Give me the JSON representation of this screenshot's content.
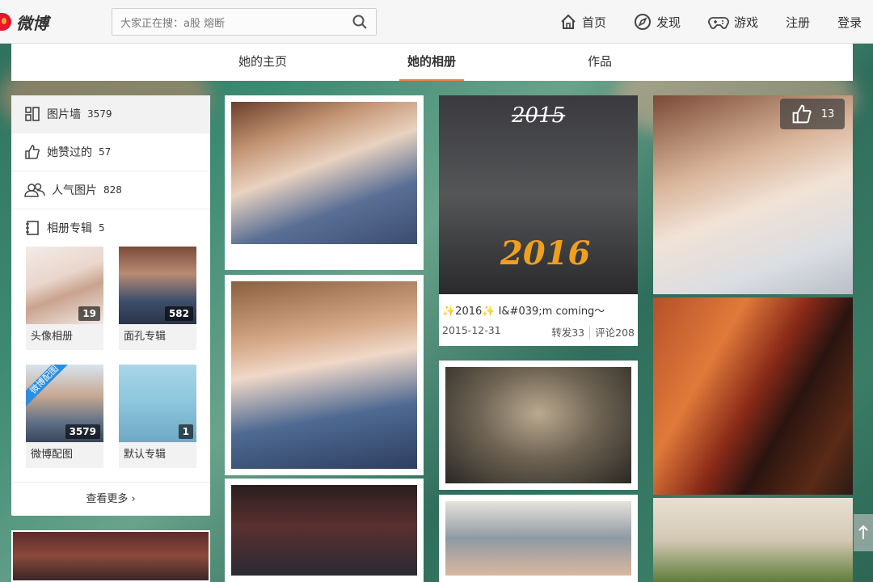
{
  "header": {
    "logo_text": "微博",
    "search_placeholder": "大家正在搜：a股 熔断",
    "nav": [
      {
        "label": "首页",
        "icon": "home-icon"
      },
      {
        "label": "发现",
        "icon": "compass-icon"
      },
      {
        "label": "游戏",
        "icon": "gamepad-icon"
      },
      {
        "label": "注册"
      },
      {
        "label": "登录"
      }
    ]
  },
  "tabs": [
    {
      "label": "她的主页",
      "active": false
    },
    {
      "label": "她的相册",
      "active": true
    },
    {
      "label": "作品",
      "active": false
    }
  ],
  "sidebar": {
    "items": [
      {
        "label": "图片墙",
        "count": "3579",
        "icon": "grid-icon",
        "active": true
      },
      {
        "label": "她赞过的",
        "count": "57",
        "icon": "thumbs-up-icon",
        "active": false
      },
      {
        "label": "人气图片",
        "count": "828",
        "icon": "people-icon",
        "active": false
      }
    ],
    "albums_title": "相册专辑",
    "albums_count": "5",
    "albums": [
      {
        "label": "头像相册",
        "count": "19"
      },
      {
        "label": "面孔专辑",
        "count": "582"
      },
      {
        "label": "微博配图",
        "count": "3579",
        "ribbon": "微博配图"
      },
      {
        "label": "默认专辑",
        "count": "1"
      }
    ],
    "see_more": "查看更多 ›"
  },
  "feed": {
    "featured_caption": "✨2016✨ I&#039;m coming～",
    "featured_date": "2015-12-31",
    "featured_reposts": "转发33",
    "featured_comments": "评论208",
    "featured_photo_text_top": "2015",
    "featured_photo_text_bottom": "2016",
    "like_count": "13"
  },
  "colors": {
    "accent": "#fa7d3c",
    "brand_red": "#e6162d"
  }
}
